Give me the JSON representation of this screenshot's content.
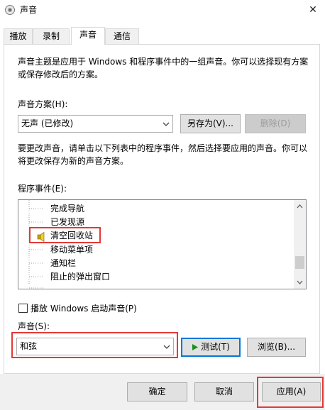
{
  "window": {
    "title": "声音",
    "close_glyph": "✕"
  },
  "tabs": [
    {
      "label": "播放"
    },
    {
      "label": "录制"
    },
    {
      "label": "声音"
    },
    {
      "label": "通信"
    }
  ],
  "scheme": {
    "intro": "声音主题是应用于 Windows 和程序事件中的一组声音。你可以选择现有方案或保存修改后的方案。",
    "label": "声音方案(H):",
    "selected": "无声 (已修改)",
    "save_as_label": "另存为(V)...",
    "delete_label": "删除(D)"
  },
  "events": {
    "instructions": "要更改声音，请单击以下列表中的程序事件，然后选择要应用的声音。你可以将更改保存为新的声音方案。",
    "label": "程序事件(E):",
    "items": [
      {
        "label": "完成导航"
      },
      {
        "label": "已发现源"
      },
      {
        "label": "清空回收站"
      },
      {
        "label": "移动菜单项"
      },
      {
        "label": "通知栏"
      },
      {
        "label": "阻止的弹出窗口"
      }
    ],
    "selected_index": 2
  },
  "startup": {
    "checkbox_label": "播放 Windows 启动声音(P)",
    "checked": false
  },
  "sound": {
    "label": "声音(S):",
    "selected": "和弦",
    "test_label": "测试(T)",
    "browse_label": "浏览(B)..."
  },
  "footer": {
    "ok_label": "确定",
    "cancel_label": "取消",
    "apply_label": "应用(A)"
  },
  "colors": {
    "highlight_red": "#e53935",
    "focus_blue": "#0078d7",
    "play_green": "#1a8f1a"
  }
}
